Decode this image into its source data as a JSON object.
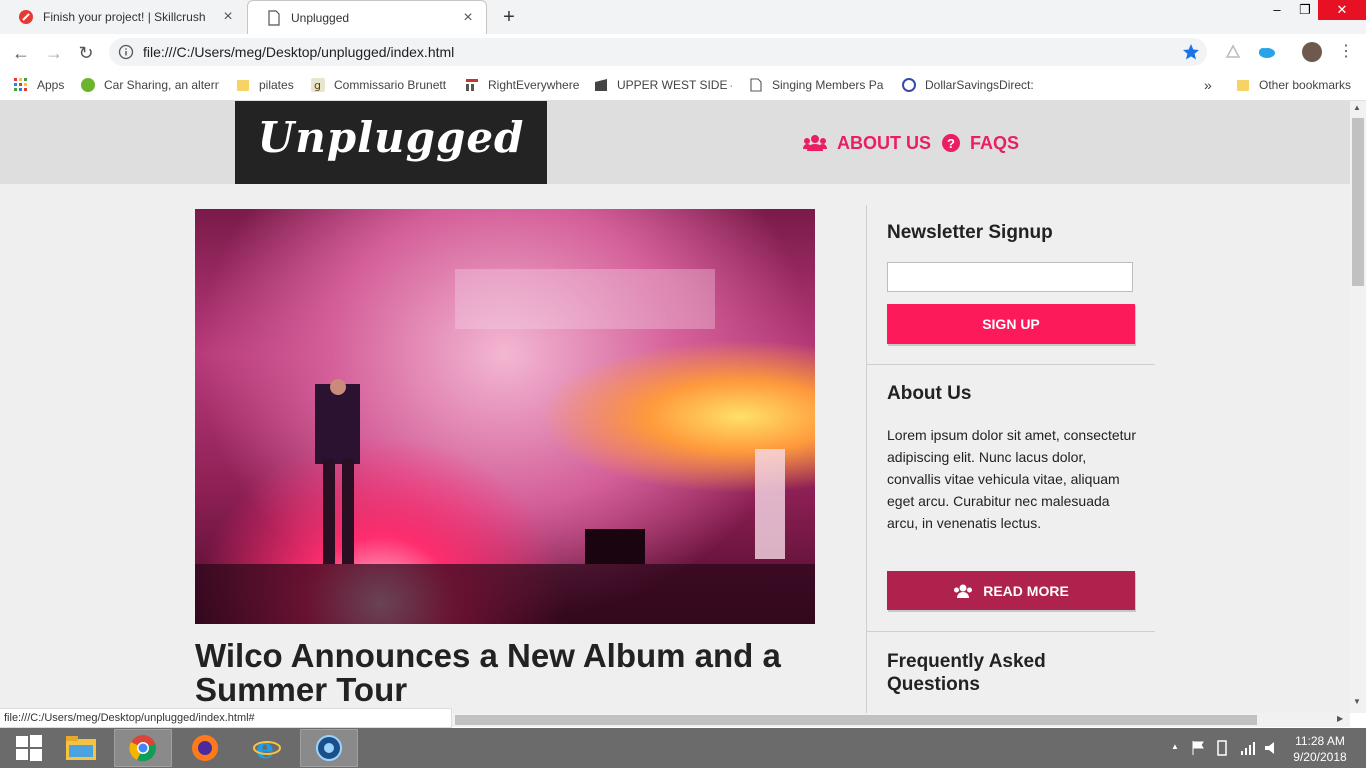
{
  "browser": {
    "tabs": [
      {
        "title": "Finish your project! | Skillcrush",
        "icon": "skillcrush-icon",
        "active": false
      },
      {
        "title": "Unplugged",
        "icon": "page-icon",
        "active": true
      }
    ],
    "window_controls": {
      "minimize": "–",
      "restore": "❐",
      "close": "✕"
    },
    "url": "file:///C:/Users/meg/Desktop/unplugged/index.html",
    "bookmarks": [
      {
        "label": "Apps",
        "icon": "apps-grid-icon"
      },
      {
        "label": "Car Sharing, an altern",
        "icon": "zipcar-icon"
      },
      {
        "label": "pilates",
        "icon": "folder-icon"
      },
      {
        "label": "Commissario Brunetti",
        "icon": "goodreads-icon"
      },
      {
        "label": "RightEverywhere",
        "icon": "chart-icon"
      },
      {
        "label": "UPPER WEST SIDE —",
        "icon": "bookmark-icon"
      },
      {
        "label": "Singing Members Pa",
        "icon": "page-icon"
      },
      {
        "label": "DollarSavingsDirect:",
        "icon": "bank-icon"
      }
    ],
    "bookmarks_overflow": "»",
    "other_bookmarks": "Other bookmarks",
    "status_url": "file:///C:/Users/meg/Desktop/unplugged/index.html#"
  },
  "site": {
    "logo": "Unplugged",
    "nav": [
      {
        "label": "ABOUT US",
        "icon": "users-icon"
      },
      {
        "label": "FAQS",
        "icon": "question-circle-icon"
      }
    ],
    "headline": "Wilco Announces a New Album and a Summer Tour",
    "sidebar": {
      "newsletter_title": "Newsletter Signup",
      "newsletter_placeholder": "",
      "signup_label": "SIGN UP",
      "about_title": "About Us",
      "about_text": "Lorem ipsum dolor sit amet, consectetur adipiscing elit. Nunc lacus dolor, convallis vitae vehicula vitae, aliquam eget arcu. Curabitur nec malesuada arcu, in venenatis lectus.",
      "read_more_label": "READ MORE",
      "faq_title": "Frequently Asked Questions"
    },
    "colors": {
      "accent": "#fc1a5a",
      "read_more": "#b0224e",
      "logo_bg": "#232323"
    }
  },
  "taskbar": {
    "apps": [
      "start-icon",
      "file-explorer-icon",
      "chrome-icon",
      "firefox-icon",
      "ie-icon",
      "app-globe-icon"
    ],
    "time": "11:28 AM",
    "date": "9/20/2018"
  }
}
